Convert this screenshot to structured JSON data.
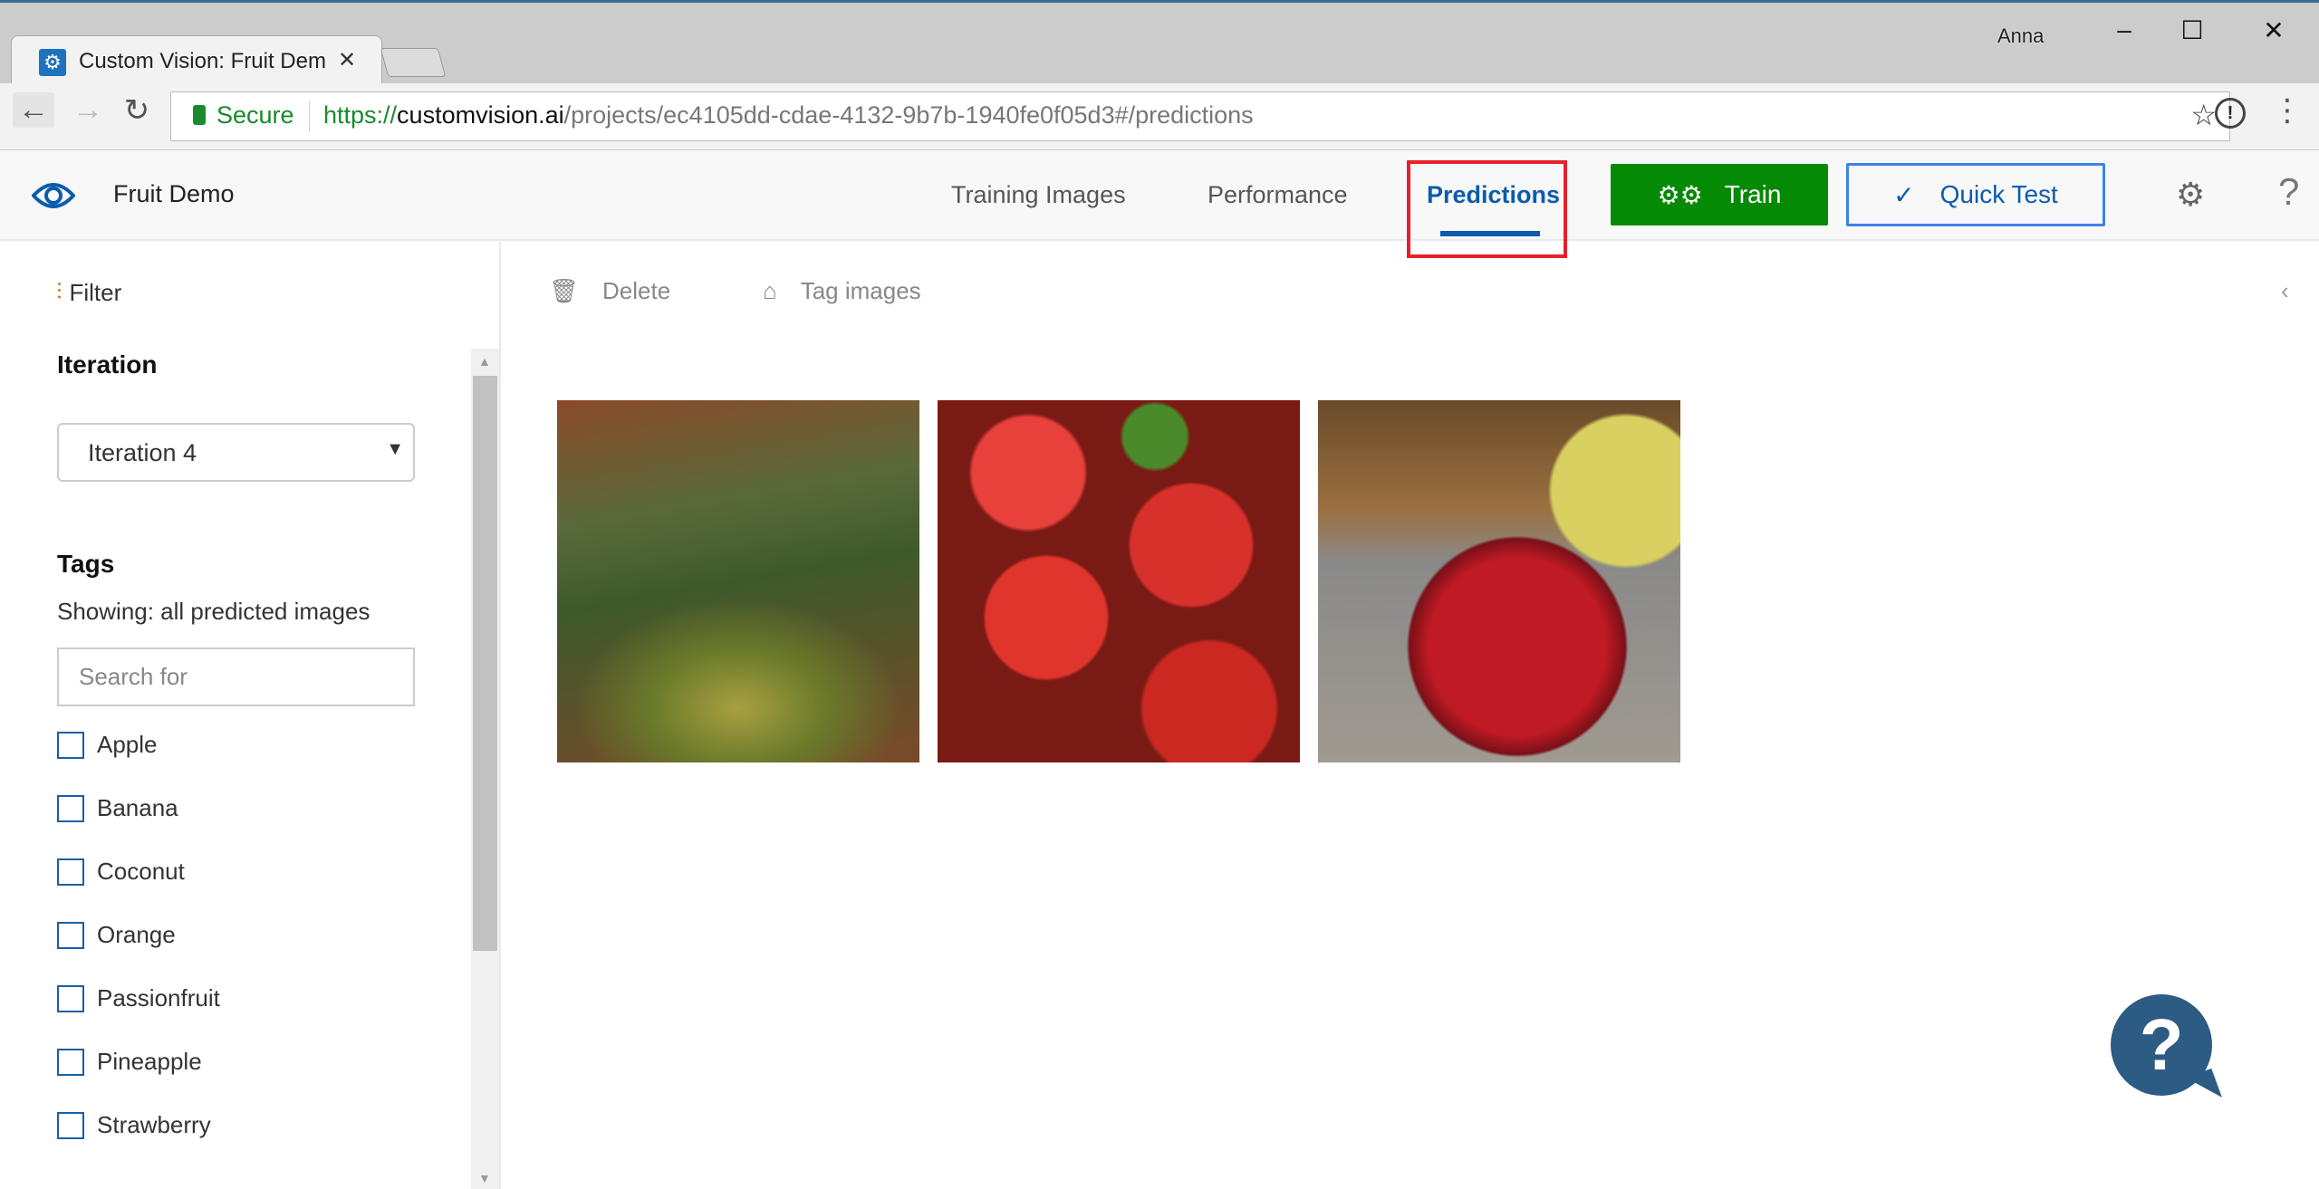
{
  "browser": {
    "tab_title": "Custom Vision: Fruit Dem",
    "user": "Anna",
    "secure_label": "Secure",
    "url_scheme": "https://",
    "url_host": "customvision.ai",
    "url_path": "/projects/ec4105dd-cdae-4132-9b7b-1940fe0f05d3#/predictions"
  },
  "header": {
    "project": "Fruit Demo",
    "nav": [
      {
        "label": "Training Images"
      },
      {
        "label": "Performance"
      },
      {
        "label": "Predictions",
        "active": true
      }
    ],
    "train_label": "Train",
    "quick_test_label": "Quick Test",
    "highlight_color": "#e8202a",
    "train_color": "#048a04",
    "accent": "#0b5cad"
  },
  "sidebar": {
    "filter_label": "Filter",
    "iteration_heading": "Iteration",
    "iteration_selected": "Iteration 4",
    "tags_heading": "Tags",
    "showing": "Showing: all predicted images",
    "search_placeholder": "Search for",
    "tags": [
      {
        "label": "Apple"
      },
      {
        "label": "Banana"
      },
      {
        "label": "Coconut"
      },
      {
        "label": "Orange"
      },
      {
        "label": "Passionfruit"
      },
      {
        "label": "Pineapple"
      },
      {
        "label": "Strawberry"
      }
    ]
  },
  "toolbar": {
    "delete_label": "Delete",
    "tag_label": "Tag images"
  },
  "images": [
    {
      "subject": "pineapple"
    },
    {
      "subject": "strawberries"
    },
    {
      "subject": "apple"
    }
  ]
}
